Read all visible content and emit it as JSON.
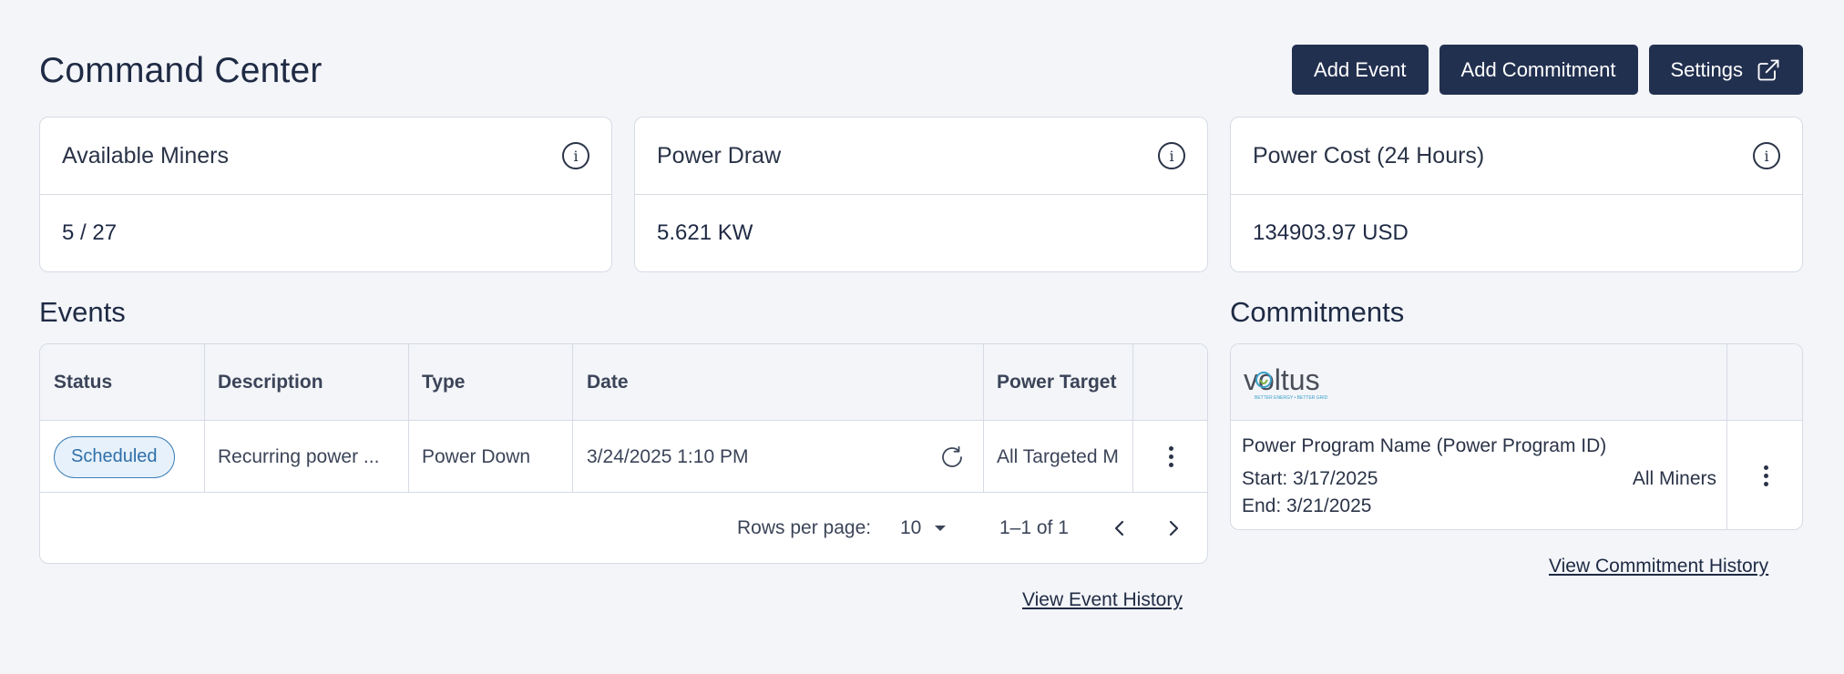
{
  "header": {
    "title": "Command Center",
    "buttons": {
      "add_event": "Add Event",
      "add_commitment": "Add Commitment",
      "settings": "Settings"
    }
  },
  "cards": [
    {
      "title": "Available Miners",
      "value": "5 / 27",
      "icon": "info-icon"
    },
    {
      "title": "Power Draw",
      "value": "5.621 KW",
      "icon": "info-icon"
    },
    {
      "title": "Power Cost (24 Hours)",
      "value": "134903.97 USD",
      "icon": "info-icon"
    }
  ],
  "events": {
    "title": "Events",
    "columns": [
      "Status",
      "Description",
      "Type",
      "Date",
      "Power Target"
    ],
    "rows": [
      {
        "status": "Scheduled",
        "description": "Recurring power ...",
        "type": "Power Down",
        "date": "3/24/2025 1:10 PM",
        "power_target": "All Targeted M"
      }
    ],
    "pagination": {
      "rows_per_page_label": "Rows per page:",
      "rows_per_page": "10",
      "range": "1–1 of 1"
    },
    "history_link": "View Event History"
  },
  "commitments": {
    "title": "Commitments",
    "logo_text": "voltus",
    "logo_tagline": "BETTER ENERGY • BETTER GRID",
    "item": {
      "name": "Power Program Name (Power Program ID)",
      "start": "Start: 3/17/2025",
      "end": "End: 3/21/2025",
      "scope": "All Miners"
    },
    "history_link": "View Commitment History"
  },
  "colors": {
    "primary_button": "#223050",
    "status_scheduled": "#2f6fa8",
    "background": "#f3f5f9"
  }
}
